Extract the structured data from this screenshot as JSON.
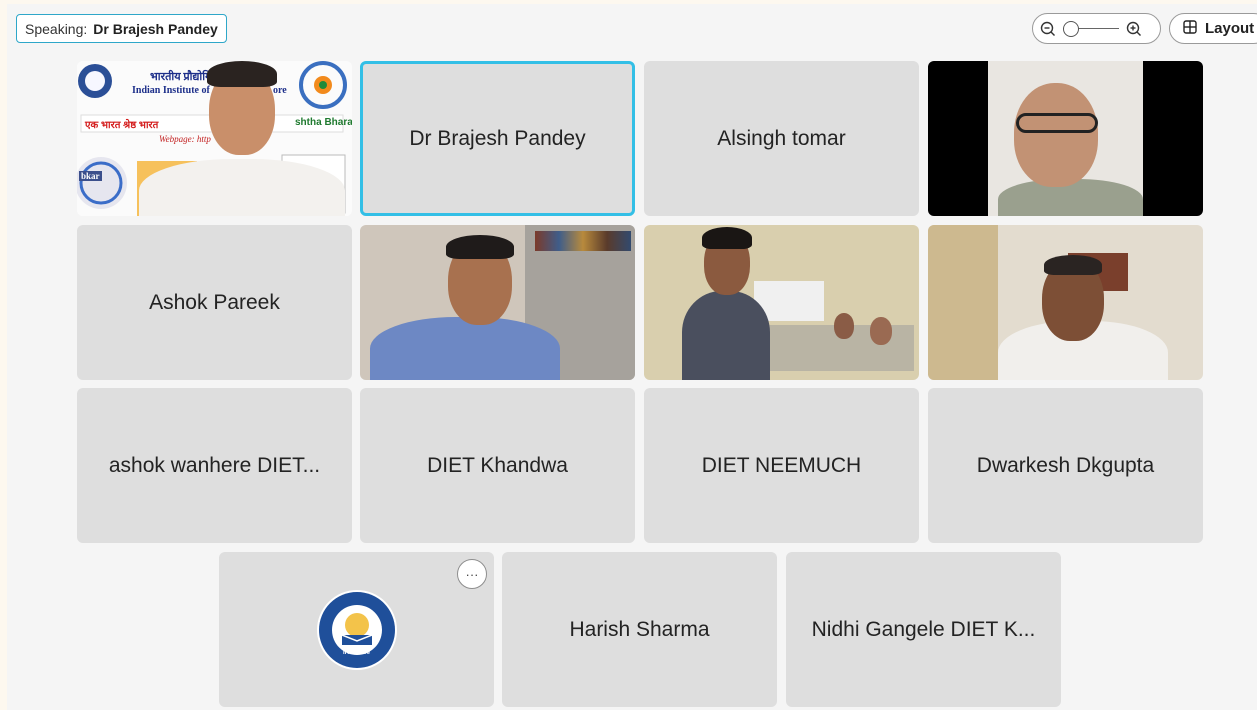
{
  "speaking": {
    "prefix": "Speaking:",
    "name": "Dr Brajesh Pandey"
  },
  "toolbar": {
    "layout_label": "Layout",
    "zoom_level": 0
  },
  "banner": {
    "hindi_title": "भारतीय प्रौद्योगिकी",
    "english_title": "Indian Institute of",
    "english_title_end": "ore",
    "ebsb_hindi": "एक भारत श्रेष्ठ भारत",
    "ebsb_english": "shtha Bharat",
    "webpage": "Webpage: http",
    "logo_text": "bkar"
  },
  "participants": [
    {
      "name": "",
      "video": true
    },
    {
      "name": "Dr Brajesh Pandey",
      "video": false,
      "active": true
    },
    {
      "name": "Alsingh tomar",
      "video": false
    },
    {
      "name": "",
      "video": true
    },
    {
      "name": "Ashok Pareek",
      "video": false
    },
    {
      "name": "",
      "video": true
    },
    {
      "name": "",
      "video": true
    },
    {
      "name": "",
      "video": true
    },
    {
      "name": "ashok wanhere DIET...",
      "video": false
    },
    {
      "name": "DIET Khandwa",
      "video": false
    },
    {
      "name": "DIET NEEMUCH",
      "video": false
    },
    {
      "name": "Dwarkesh Dkgupta",
      "video": false
    },
    {
      "name": "",
      "video": false,
      "avatar": "iit-indore-logo"
    },
    {
      "name": "Harish Sharma",
      "video": false
    },
    {
      "name": "Nidhi Gangele DIET K...",
      "video": false
    }
  ],
  "avatar_logo_text": "IIT Indore",
  "more_label": "···"
}
